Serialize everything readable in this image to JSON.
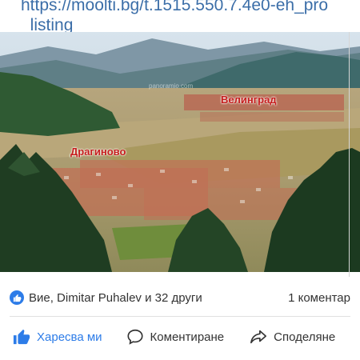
{
  "post": {
    "link_text": "https://moolti.bg/t.1515.550.7.4e0-eh_pro\n_listing"
  },
  "photo": {
    "label_left": "Драгиново",
    "label_right": "Велинград",
    "watermark": "panoramio.com"
  },
  "reactions": {
    "summary": "Вие, Dimitar Puhalev и 32 други",
    "comments_count": "1 коментар",
    "icon": "like-icon"
  },
  "actions": {
    "like": "Харесва ми",
    "comment": "Коментиране",
    "share": "Споделяне"
  },
  "colors": {
    "accent": "#2d7ce8",
    "link": "#3b6ea8",
    "photo_label": "#c61d1d"
  }
}
